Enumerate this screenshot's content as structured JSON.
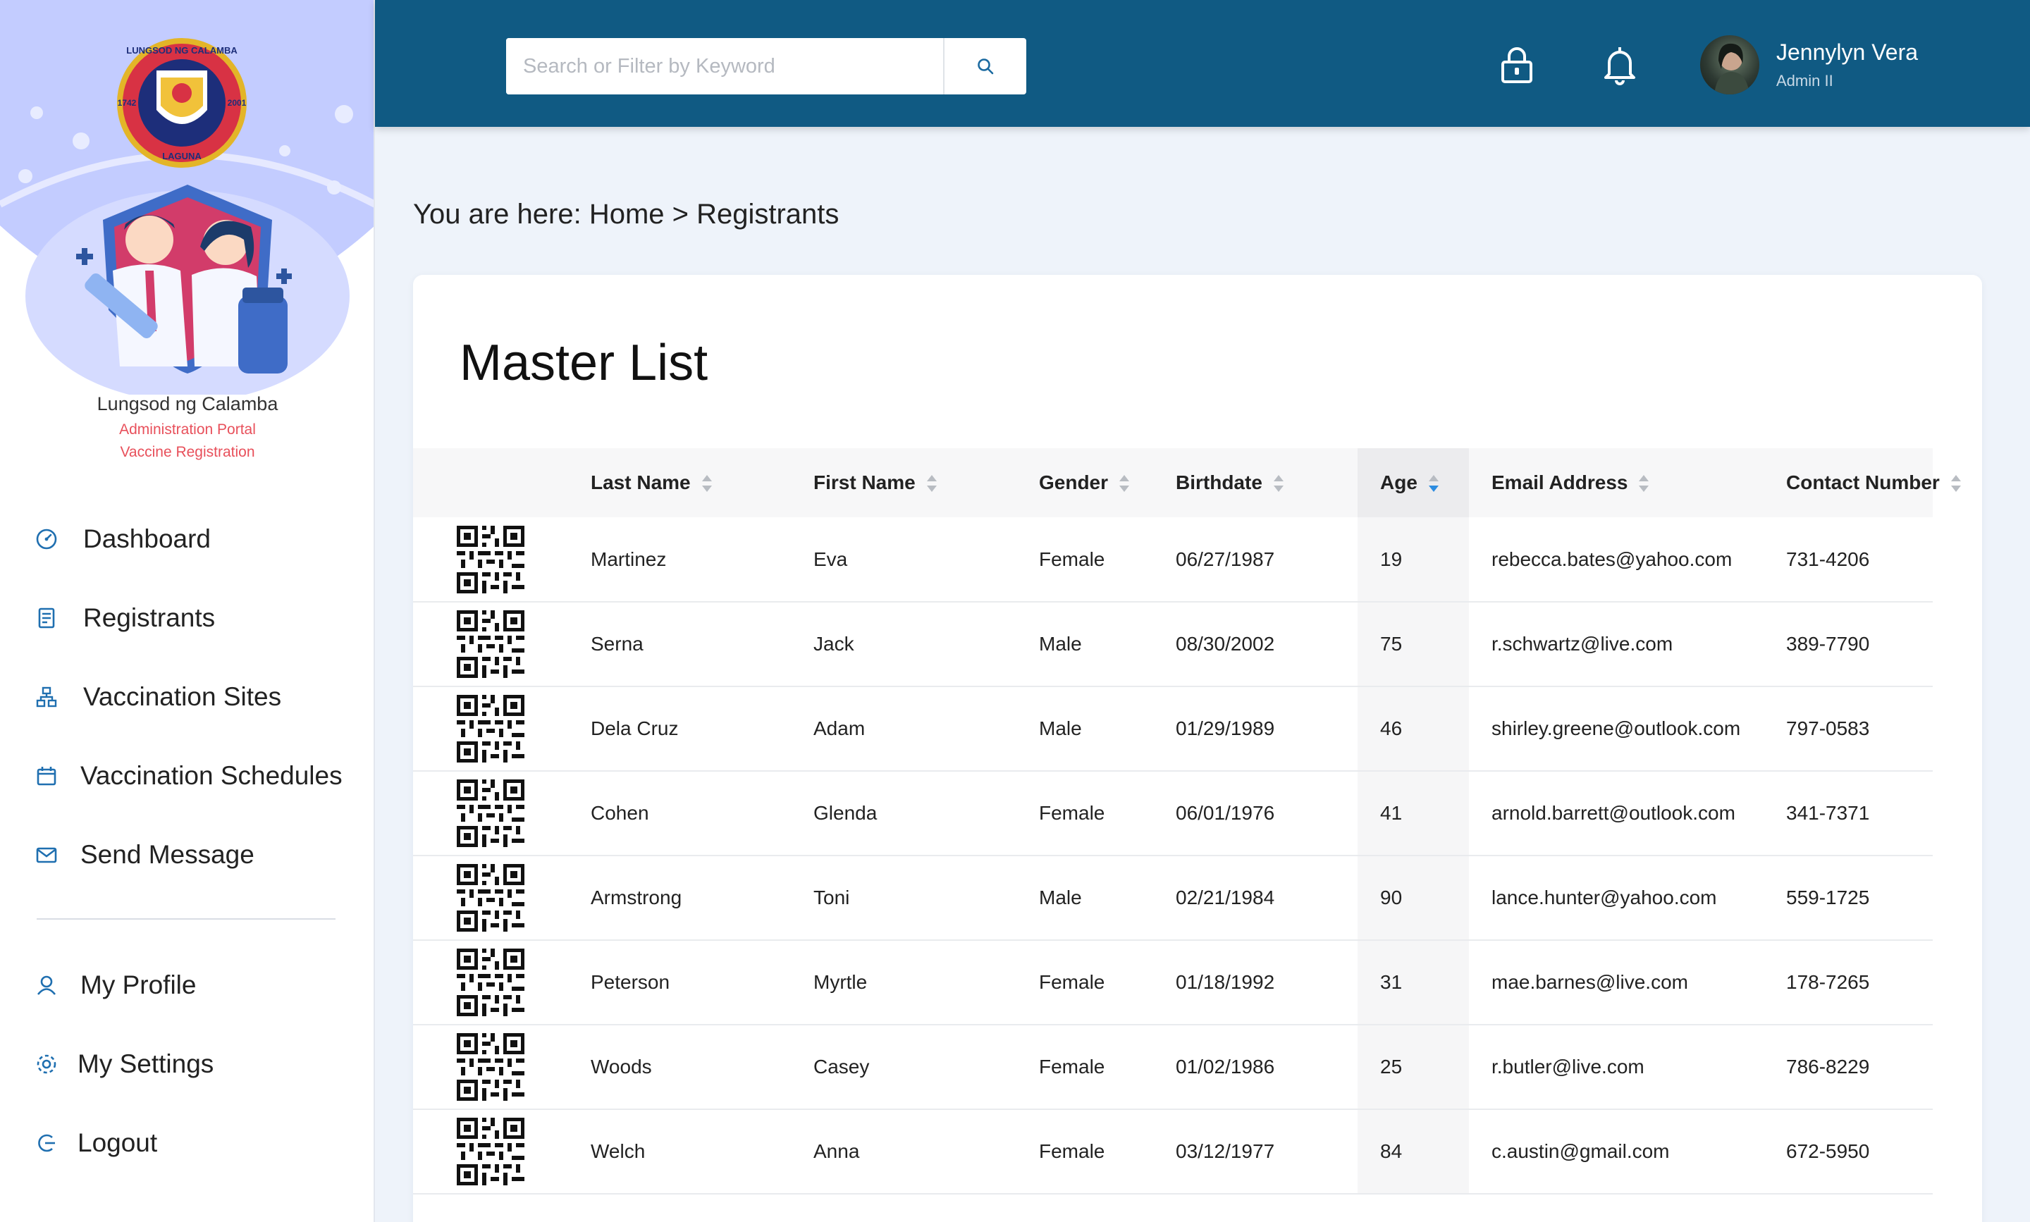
{
  "sidebar": {
    "org_name": "Lungsod ng Calamba",
    "org_sub1": "Administration Portal",
    "org_sub2": "Vaccine Registration",
    "seal_text_top": "LUNGSOD NG CALAMBA",
    "seal_text_bottom": "LAGUNA",
    "seal_year_left": "1742",
    "seal_year_right": "2001",
    "nav": [
      {
        "label": "Dashboard",
        "icon": "gauge-icon"
      },
      {
        "label": "Registrants",
        "icon": "document-list-icon"
      },
      {
        "label": "Vaccination Sites",
        "icon": "sitemap-icon"
      },
      {
        "label": "Vaccination Schedules",
        "icon": "calendar-icon"
      },
      {
        "label": "Send Message",
        "icon": "envelope-icon"
      }
    ],
    "account": [
      {
        "label": "My Profile",
        "icon": "user-icon"
      },
      {
        "label": "My Settings",
        "icon": "gear-icon"
      },
      {
        "label": "Logout",
        "icon": "logout-icon"
      }
    ]
  },
  "header": {
    "search_placeholder": "Search or Filter by Keyword",
    "user_name": "Jennylyn Vera",
    "user_role": "Admin II"
  },
  "breadcrumb": "You are here: Home > Registrants",
  "main": {
    "title": "Master List",
    "columns": [
      "",
      "Last Name",
      "First Name",
      "Gender",
      "Birthdate",
      "Age",
      "Email Address",
      "Contact Number"
    ],
    "sorted_column": "Age",
    "sort_direction": "descending",
    "rows": [
      [
        "Martinez",
        "Eva",
        "Female",
        "06/27/1987",
        "19",
        "rebecca.bates@yahoo.com",
        "731-4206"
      ],
      [
        "Serna",
        "Jack",
        "Male",
        "08/30/2002",
        "75",
        "r.schwartz@live.com",
        "389-7790"
      ],
      [
        "Dela Cruz",
        "Adam",
        "Male",
        "01/29/1989",
        "46",
        "shirley.greene@outlook.com",
        "797-0583"
      ],
      [
        "Cohen",
        "Glenda",
        "Female",
        "06/01/1976",
        "41",
        "arnold.barrett@outlook.com",
        "341-7371"
      ],
      [
        "Armstrong",
        "Toni",
        "Male",
        "02/21/1984",
        "90",
        "lance.hunter@yahoo.com",
        "559-1725"
      ],
      [
        "Peterson",
        "Myrtle",
        "Female",
        "01/18/1992",
        "31",
        "mae.barnes@live.com",
        "178-7265"
      ],
      [
        "Woods",
        "Casey",
        "Female",
        "01/02/1986",
        "25",
        "r.butler@live.com",
        "786-8229"
      ],
      [
        "Welch",
        "Anna",
        "Female",
        "03/12/1977",
        "84",
        "c.austin@gmail.com",
        "672-5950"
      ]
    ]
  },
  "colors": {
    "header_bg": "#105a83",
    "page_bg": "#eef3fa",
    "accent_red": "#e8505b",
    "sort_active": "#2d8ce0",
    "sidebar_hero": "#c3ccff"
  }
}
